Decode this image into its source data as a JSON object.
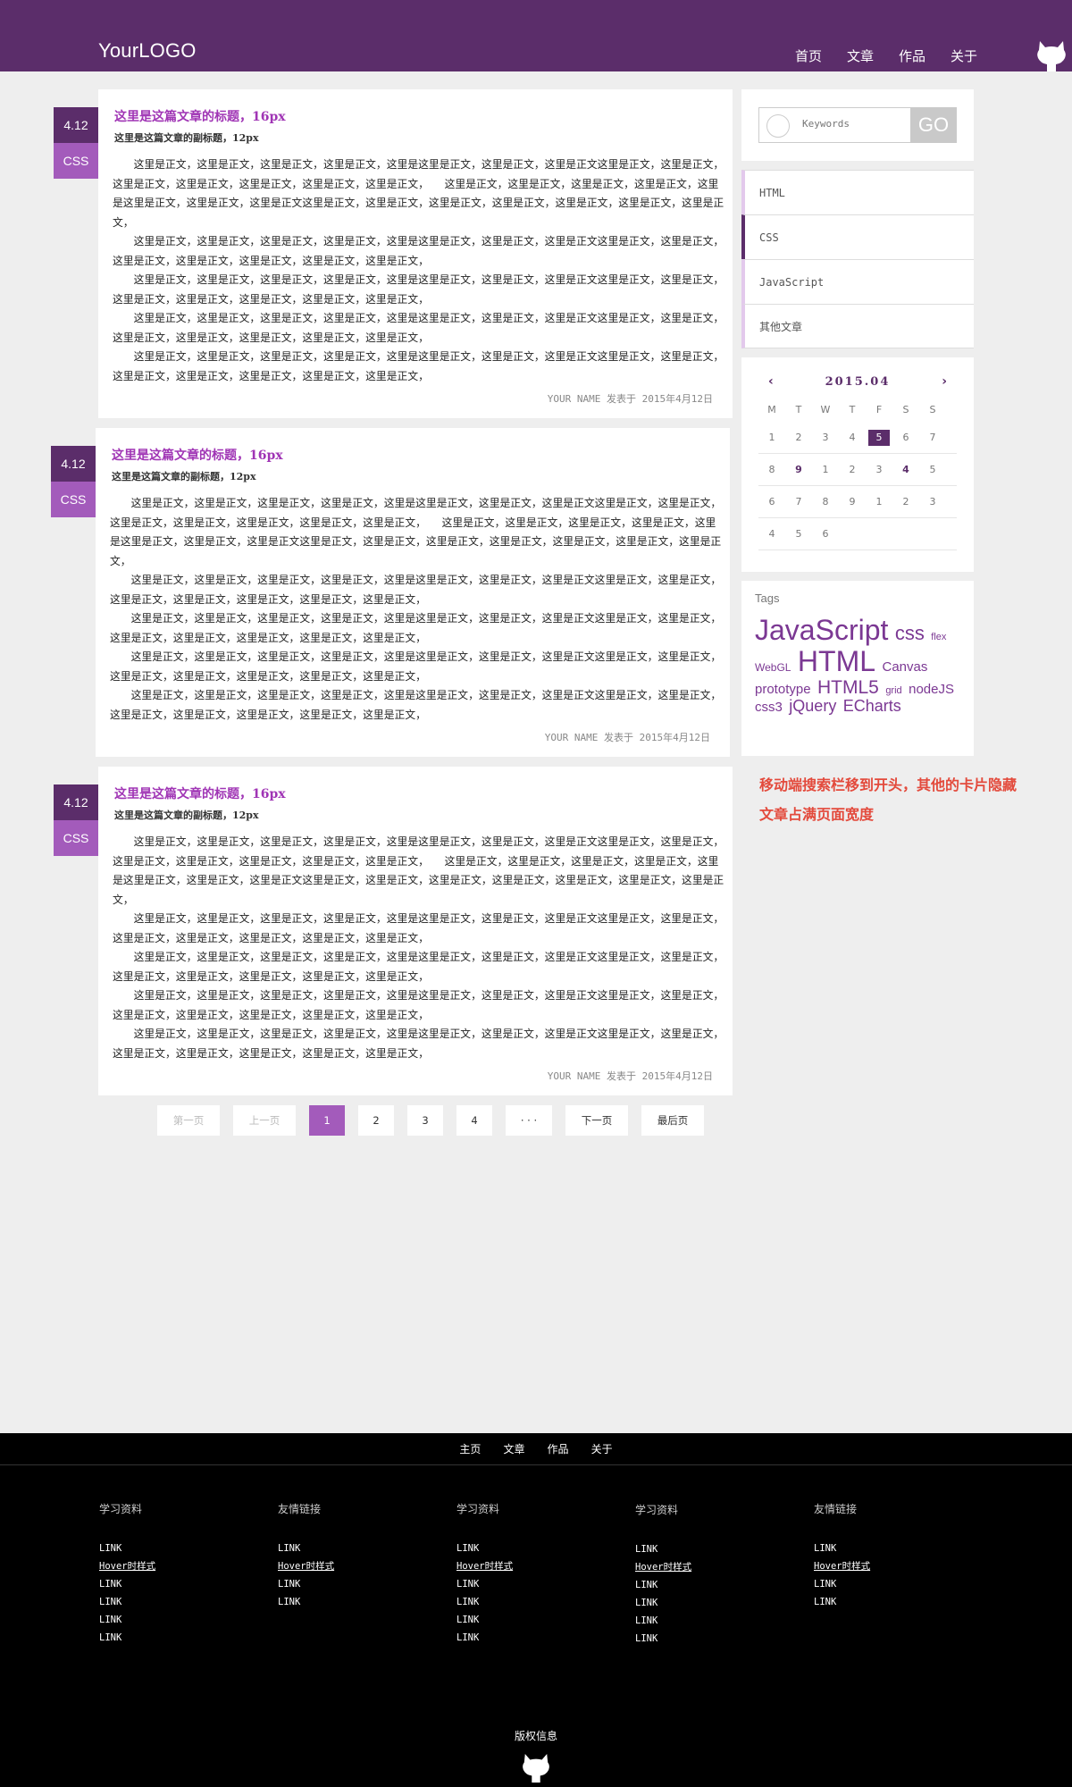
{
  "header": {
    "logo": "YourLOGO",
    "nav": [
      "首页",
      "文章",
      "作品",
      "关于"
    ],
    "brand_color": "#5b2d6a",
    "icon": "github-icon"
  },
  "articles": [
    {
      "date": "4.12",
      "category": "CSS",
      "title": "这里是这篇文章的标题，16px",
      "subtitle": "这里是这篇文章的副标题，12px",
      "paragraphs": [
        "这里是正文，这里是正文，这里是正文，这里是正文，这里是这里是正文，这里是正文，这里是正文这里是正文，这里是正文，这里是正文，这里是正文，这里是正文，这里是正文，这里是正文，　　这里是正文，这里是正文，这里是正文，这里是正文，这里是这里是正文，这里是正文，这里是正文这里是正文，这里是正文，这里是正文，这里是正文，这里是正文，这里是正文，这里是正文，",
        "这里是正文，这里是正文，这里是正文，这里是正文，这里是这里是正文，这里是正文，这里是正文这里是正文，这里是正文，这里是正文，这里是正文，这里是正文，这里是正文，这里是正文，",
        "这里是正文，这里是正文，这里是正文，这里是正文，这里是这里是正文，这里是正文，这里是正文这里是正文，这里是正文，这里是正文，这里是正文，这里是正文，这里是正文，这里是正文，",
        "这里是正文，这里是正文，这里是正文，这里是正文，这里是这里是正文，这里是正文，这里是正文这里是正文，这里是正文，这里是正文，这里是正文，这里是正文，这里是正文，这里是正文，",
        "这里是正文，这里是正文，这里是正文，这里是正文，这里是这里是正文，这里是正文，这里是正文这里是正文，这里是正文，这里是正文，这里是正文，这里是正文，这里是正文，这里是正文，"
      ],
      "meta": "YOUR NAME 发表于 2015年4月12日"
    },
    {
      "date": "4.12",
      "category": "CSS",
      "title": "这里是这篇文章的标题，16px",
      "subtitle": "这里是这篇文章的副标题，12px",
      "paragraphs": [
        "这里是正文，这里是正文，这里是正文，这里是正文，这里是这里是正文，这里是正文，这里是正文这里是正文，这里是正文，这里是正文，这里是正文，这里是正文，这里是正文，这里是正文，　　这里是正文，这里是正文，这里是正文，这里是正文，这里是这里是正文，这里是正文，这里是正文这里是正文，这里是正文，这里是正文，这里是正文，这里是正文，这里是正文，这里是正文，",
        "这里是正文，这里是正文，这里是正文，这里是正文，这里是这里是正文，这里是正文，这里是正文这里是正文，这里是正文，这里是正文，这里是正文，这里是正文，这里是正文，这里是正文，",
        "这里是正文，这里是正文，这里是正文，这里是正文，这里是这里是正文，这里是正文，这里是正文这里是正文，这里是正文，这里是正文，这里是正文，这里是正文，这里是正文，这里是正文，",
        "这里是正文，这里是正文，这里是正文，这里是正文，这里是这里是正文，这里是正文，这里是正文这里是正文，这里是正文，这里是正文，这里是正文，这里是正文，这里是正文，这里是正文，",
        "这里是正文，这里是正文，这里是正文，这里是正文，这里是这里是正文，这里是正文，这里是正文这里是正文，这里是正文，这里是正文，这里是正文，这里是正文，这里是正文，这里是正文，"
      ],
      "meta": "YOUR NAME 发表于 2015年4月12日"
    },
    {
      "date": "4.12",
      "category": "CSS",
      "title": "这里是这篇文章的标题，16px",
      "subtitle": "这里是这篇文章的副标题，12px",
      "paragraphs": [
        "这里是正文，这里是正文，这里是正文，这里是正文，这里是这里是正文，这里是正文，这里是正文这里是正文，这里是正文，这里是正文，这里是正文，这里是正文，这里是正文，这里是正文，　　这里是正文，这里是正文，这里是正文，这里是正文，这里是这里是正文，这里是正文，这里是正文这里是正文，这里是正文，这里是正文，这里是正文，这里是正文，这里是正文，这里是正文，",
        "这里是正文，这里是正文，这里是正文，这里是正文，这里是这里是正文，这里是正文，这里是正文这里是正文，这里是正文，这里是正文，这里是正文，这里是正文，这里是正文，这里是正文，",
        "这里是正文，这里是正文，这里是正文，这里是正文，这里是这里是正文，这里是正文，这里是正文这里是正文，这里是正文，这里是正文，这里是正文，这里是正文，这里是正文，这里是正文，",
        "这里是正文，这里是正文，这里是正文，这里是正文，这里是这里是正文，这里是正文，这里是正文这里是正文，这里是正文，这里是正文，这里是正文，这里是正文，这里是正文，这里是正文，",
        "这里是正文，这里是正文，这里是正文，这里是正文，这里是这里是正文，这里是正文，这里是正文这里是正文，这里是正文，这里是正文，这里是正文，这里是正文，这里是正文，这里是正文，"
      ],
      "meta": "YOUR NAME 发表于 2015年4月12日"
    }
  ],
  "pagination": {
    "first": "第一页",
    "prev": "上一页",
    "pages": [
      "1",
      "2",
      "3",
      "4"
    ],
    "current": "1",
    "ellipsis": "· · ·",
    "next": "下一页",
    "last": "最后页"
  },
  "search": {
    "placeholder": "Keywords",
    "button": "GO",
    "icon": "search-icon"
  },
  "categories": {
    "items": [
      "HTML",
      "CSS",
      "JavaScript",
      "其他文章"
    ],
    "active": "CSS"
  },
  "calendar": {
    "month": "2015.04",
    "prev_icon": "chevron-left-icon",
    "next_icon": "chevron-right-icon",
    "weekdays": [
      "M",
      "T",
      "W",
      "T",
      "F",
      "S",
      "S"
    ],
    "rows": [
      [
        "1",
        "2",
        "3",
        "4",
        "5",
        "6",
        "7"
      ],
      [
        "8",
        "9",
        "1",
        "2",
        "3",
        "4",
        "5"
      ],
      [
        "6",
        "7",
        "8",
        "9",
        "1",
        "2",
        "3"
      ],
      [
        "4",
        "5",
        "6",
        "",
        "",
        "",
        ""
      ]
    ],
    "selected": "5",
    "highlighted": [
      "9",
      "4"
    ]
  },
  "tags": {
    "title": "Tags",
    "items": [
      "JavaScript",
      "css",
      "flex",
      "WebGL",
      "HTML",
      "Canvas",
      "prototype",
      "HTML5",
      "grid",
      "nodeJS",
      "css3",
      "jQuery",
      "ECharts"
    ]
  },
  "note": {
    "lines": [
      "移动端搜索栏移到开头，其他的卡片隐藏",
      "文章占满页面宽度"
    ],
    "color": "#e34a3c"
  },
  "footer": {
    "nav": [
      "主页",
      "文章",
      "作品",
      "关于"
    ],
    "columns": [
      {
        "title": "学习资料",
        "links": [
          "LINK",
          "Hover时样式",
          "LINK",
          "LINK",
          "LINK",
          "LINK"
        ]
      },
      {
        "title": "友情链接",
        "links": [
          "LINK",
          "Hover时样式",
          "LINK",
          "LINK"
        ]
      },
      {
        "title": "学习资料",
        "links": [
          "LINK",
          "Hover时样式",
          "LINK",
          "LINK",
          "LINK",
          "LINK"
        ]
      },
      {
        "title": "学习资料",
        "links": [
          "LINK",
          "Hover时样式",
          "LINK",
          "LINK",
          "LINK",
          "LINK"
        ]
      },
      {
        "title": "友情链接",
        "links": [
          "LINK",
          "Hover时样式",
          "LINK",
          "LINK"
        ]
      }
    ],
    "copyright": "版权信息",
    "icon": "github-icon"
  }
}
